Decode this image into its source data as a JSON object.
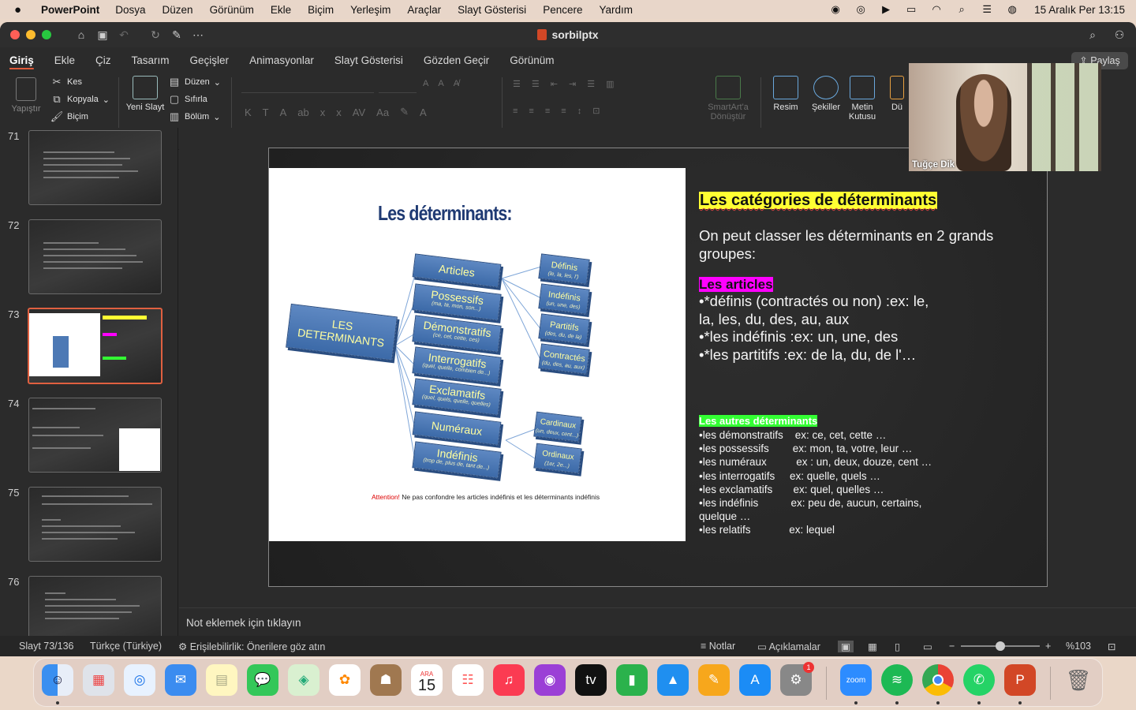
{
  "menubar": {
    "app_name": "PowerPoint",
    "items": [
      "Dosya",
      "Düzen",
      "Görünüm",
      "Ekle",
      "Biçim",
      "Yerleşim",
      "Araçlar",
      "Slayt Gösterisi",
      "Pencere",
      "Yardım"
    ],
    "clock": "15 Aralık Per  13:15"
  },
  "window": {
    "title": "sorbilptx"
  },
  "ribbon_tabs": [
    "Giriş",
    "Ekle",
    "Çiz",
    "Tasarım",
    "Geçişler",
    "Animasyonlar",
    "Slayt Gösterisi",
    "Gözden Geçir",
    "Görünüm"
  ],
  "share_label": "Paylaş",
  "ribbon": {
    "paste": "Yapıştır",
    "cut": "Kes",
    "copy": "Kopyala",
    "format": "Biçim",
    "new_slide": "Yeni Slayt",
    "layout": "Düzen",
    "reset": "Sıfırla",
    "section": "Bölüm",
    "smartart": "SmartArt'a Dönüştür",
    "picture": "Resim",
    "shapes": "Şekiller",
    "textbox": "Metin Kutusu",
    "arrange": "Dü"
  },
  "thumbnails": [
    {
      "num": "71"
    },
    {
      "num": "72"
    },
    {
      "num": "73",
      "selected": true
    },
    {
      "num": "74"
    },
    {
      "num": "75"
    },
    {
      "num": "76"
    }
  ],
  "slide": {
    "diagram_title": "Les déterminants:",
    "root_box": "LES DETERMINANTS",
    "categories": [
      {
        "label": "Articles",
        "sub": ""
      },
      {
        "label": "Possessifs",
        "sub": "(ma, ta, mon, son...)"
      },
      {
        "label": "Démonstratifs",
        "sub": "(ce, cet, cette, ces)"
      },
      {
        "label": "Interrogatifs",
        "sub": "(quel, quelle, combien de...)"
      },
      {
        "label": "Exclamatifs",
        "sub": "(quel, quels, quelle, quelles)"
      },
      {
        "label": "Numéraux",
        "sub": ""
      },
      {
        "label": "Indéfinis",
        "sub": "(trop de, plus de, tant de...)"
      }
    ],
    "article_types": [
      {
        "label": "Définis",
        "sub": "(le, la, les, l')"
      },
      {
        "label": "Indéfinis",
        "sub": "(un, une, des)"
      },
      {
        "label": "Partitifs",
        "sub": "(des, du, de la)"
      },
      {
        "label": "Contractés",
        "sub": "(du, des, au, aux)"
      }
    ],
    "numeral_types": [
      {
        "label": "Cardinaux",
        "sub": "(un, deux, cent...)"
      },
      {
        "label": "Ordinaux",
        "sub": "(1er, 2e...)"
      }
    ],
    "attention_red": "Attention!",
    "attention_text": " Ne pas confondre les articles indéfinis et les déterminants indéfinis",
    "heading": "Les catégories de déterminants",
    "intro": "On peut classer les déterminants en 2 grands groupes:",
    "articles_heading": "Les articles",
    "article_lines": [
      "•*définis (contractés ou non) :ex: le,",
      "la, les, du, des, au, aux",
      "•*les  indéfinis :ex: un, une, des",
      "•*les partitifs  :ex: de la, du, de l'…"
    ],
    "others_heading": "Les autres déterminants",
    "other_lines": [
      "•les démonstratifs    ex: ce, cet, cette …",
      "•les possessifs        ex: mon, ta, votre, leur …",
      "•les numéraux          ex : un, deux, douze, cent …",
      "•les interrogatifs     ex: quelle, quels …",
      "•les exclamatifs       ex: quel, quelles …",
      "•les indéfinis           ex: peu de, aucun, certains,",
      "quelque …",
      "•les relatifs             ex: lequel"
    ]
  },
  "webcam": {
    "name": "Tuğçe Dik"
  },
  "notes_placeholder": "Not eklemek için tıklayın",
  "statusbar": {
    "slide_counter": "Slayt 73/136",
    "language": "Türkçe (Türkiye)",
    "accessibility": "Erişilebilirlik: Önerilere göz atın",
    "notes": "Notlar",
    "comments": "Açıklamalar",
    "zoom": "%103"
  },
  "dock": {
    "calendar_month": "ARA",
    "calendar_day": "15",
    "settings_badge": "1",
    "zoom_label": "zoom"
  }
}
